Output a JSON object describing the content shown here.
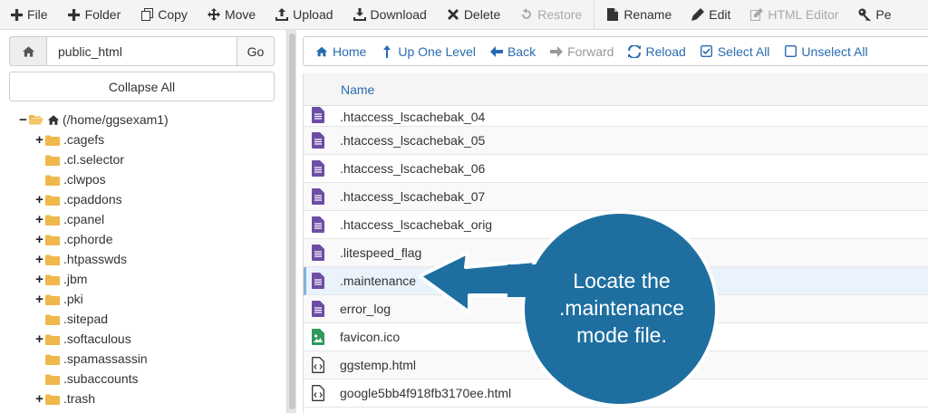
{
  "toolbar": {
    "buttons": [
      {
        "label": "File",
        "icon": "plus-icon",
        "enabled": true
      },
      {
        "label": "Folder",
        "icon": "plus-icon",
        "enabled": true
      },
      {
        "label": "Copy",
        "icon": "copy-icon",
        "enabled": true
      },
      {
        "label": "Move",
        "icon": "move-icon",
        "enabled": true
      },
      {
        "label": "Upload",
        "icon": "upload-icon",
        "enabled": true
      },
      {
        "label": "Download",
        "icon": "download-icon",
        "enabled": true
      },
      {
        "label": "Delete",
        "icon": "close-icon",
        "enabled": true
      },
      {
        "label": "Restore",
        "icon": "undo-icon",
        "enabled": false
      },
      {
        "label": "Rename",
        "icon": "file-icon",
        "enabled": true
      },
      {
        "label": "Edit",
        "icon": "pencil-icon",
        "enabled": true
      },
      {
        "label": "HTML Editor",
        "icon": "edit-icon",
        "enabled": false
      },
      {
        "label": "Pe",
        "icon": "key-icon",
        "enabled": true
      }
    ]
  },
  "path_bar": {
    "value": "public_html",
    "go_label": "Go"
  },
  "collapse_label": "Collapse All",
  "tree": {
    "root_label": "(/home/ggsexam1)",
    "items": [
      {
        "label": ".cagefs",
        "expandable": true
      },
      {
        "label": ".cl.selector",
        "expandable": false
      },
      {
        "label": ".clwpos",
        "expandable": false
      },
      {
        "label": ".cpaddons",
        "expandable": true
      },
      {
        "label": ".cpanel",
        "expandable": true
      },
      {
        "label": ".cphorde",
        "expandable": true
      },
      {
        "label": ".htpasswds",
        "expandable": true
      },
      {
        "label": ".jbm",
        "expandable": true
      },
      {
        "label": ".pki",
        "expandable": true
      },
      {
        "label": ".sitepad",
        "expandable": false
      },
      {
        "label": ".softaculous",
        "expandable": true
      },
      {
        "label": ".spamassassin",
        "expandable": false
      },
      {
        "label": ".subaccounts",
        "expandable": false
      },
      {
        "label": ".trash",
        "expandable": true
      }
    ]
  },
  "nav": {
    "buttons": [
      {
        "label": "Home",
        "icon": "home-icon",
        "enabled": true
      },
      {
        "label": "Up One Level",
        "icon": "level-up-icon",
        "enabled": true
      },
      {
        "label": "Back",
        "icon": "arrow-left-icon",
        "enabled": true
      },
      {
        "label": "Forward",
        "icon": "arrow-right-icon",
        "enabled": false
      },
      {
        "label": "Reload",
        "icon": "reload-icon",
        "enabled": true
      },
      {
        "label": "Select All",
        "icon": "checkbox-checked-icon",
        "enabled": true
      },
      {
        "label": "Unselect All",
        "icon": "checkbox-empty-icon",
        "enabled": true
      }
    ]
  },
  "files": {
    "column_name": "Name",
    "rows": [
      {
        "name": ".htaccess_lscachebak_04",
        "type": "text"
      },
      {
        "name": ".htaccess_lscachebak_05",
        "type": "text"
      },
      {
        "name": ".htaccess_lscachebak_06",
        "type": "text"
      },
      {
        "name": ".htaccess_lscachebak_07",
        "type": "text"
      },
      {
        "name": ".htaccess_lscachebak_orig",
        "type": "text"
      },
      {
        "name": ".litespeed_flag",
        "type": "text"
      },
      {
        "name": ".maintenance",
        "type": "text",
        "selected": true
      },
      {
        "name": "error_log",
        "type": "text"
      },
      {
        "name": "favicon.ico",
        "type": "image"
      },
      {
        "name": "ggstemp.html",
        "type": "code"
      },
      {
        "name": "google5bb4f918fb3170ee.html",
        "type": "code"
      }
    ]
  },
  "callout": {
    "lines": [
      "Locate the",
      ".maintenance",
      "mode file."
    ],
    "color": "#1e6fa0"
  },
  "colors": {
    "link": "#2a6bb0",
    "folder": "#f0b84a",
    "file_text": "#6d4ea5",
    "file_image": "#2e9a5c"
  }
}
